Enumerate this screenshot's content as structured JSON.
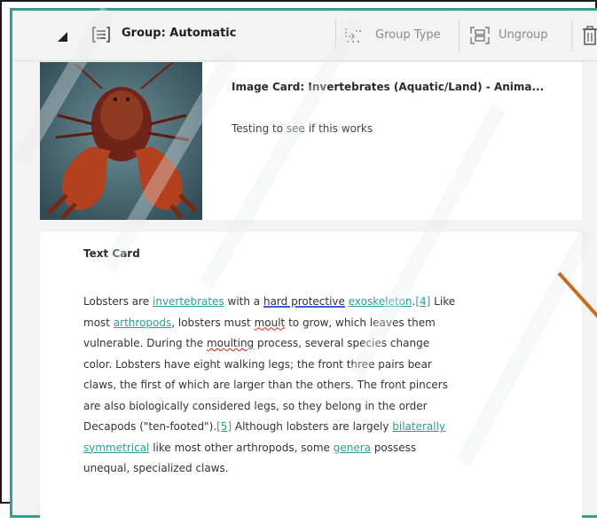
{
  "group": {
    "title": "Group: Automatic",
    "toolbar": {
      "group_type_label": "Group Type",
      "ungroup_label": "Ungroup"
    }
  },
  "image_card": {
    "title": "Image Card: Invertebrates (Aquatic/Land) - Anima...",
    "subtitle": "Testing to see if this works"
  },
  "text_card": {
    "title": "Text Card",
    "body": {
      "l1_a": "Lobsters are ",
      "l1_link1": "invertebrates",
      "l1_b": " with a ",
      "l1_gram": "hard protective",
      "l1_c": " ",
      "l1_link2": "exoskeleton",
      "l1_d": ".",
      "l1_ref": "[4]",
      "l1_e": " Like",
      "l2_a": "most ",
      "l2_link": "arthropods",
      "l2_b": ", lobsters must ",
      "l2_spell": "moult",
      "l2_c": " to grow, which leaves them",
      "l3_a": "vulnerable. During the ",
      "l3_spell": "moulting",
      "l3_b": " process, several species change",
      "l4": "color. Lobsters have eight walking legs; the front three pairs bear",
      "l5": "claws, the first of which are larger than the others. The front pincers",
      "l6": "are also biologically considered legs, so they belong in the order",
      "l7_a": "Decapods (\"ten-footed\").",
      "l7_ref": "[5]",
      "l7_b": " Although lobsters are largely ",
      "l7_link": "bilaterally",
      "l8_link": "symmetrical",
      "l8_a": " like most other arthropods, some ",
      "l8_link2": "genera",
      "l8_b": " possess",
      "l9": "unequal, specialized claws."
    }
  },
  "colors": {
    "accent": "#3a9b8f",
    "link": "#2a9e92",
    "annotation_line": "#c46d1c"
  },
  "icons": [
    "collapse-caret-icon",
    "group-icon",
    "group-type-icon",
    "ungroup-icon",
    "trash-icon"
  ]
}
